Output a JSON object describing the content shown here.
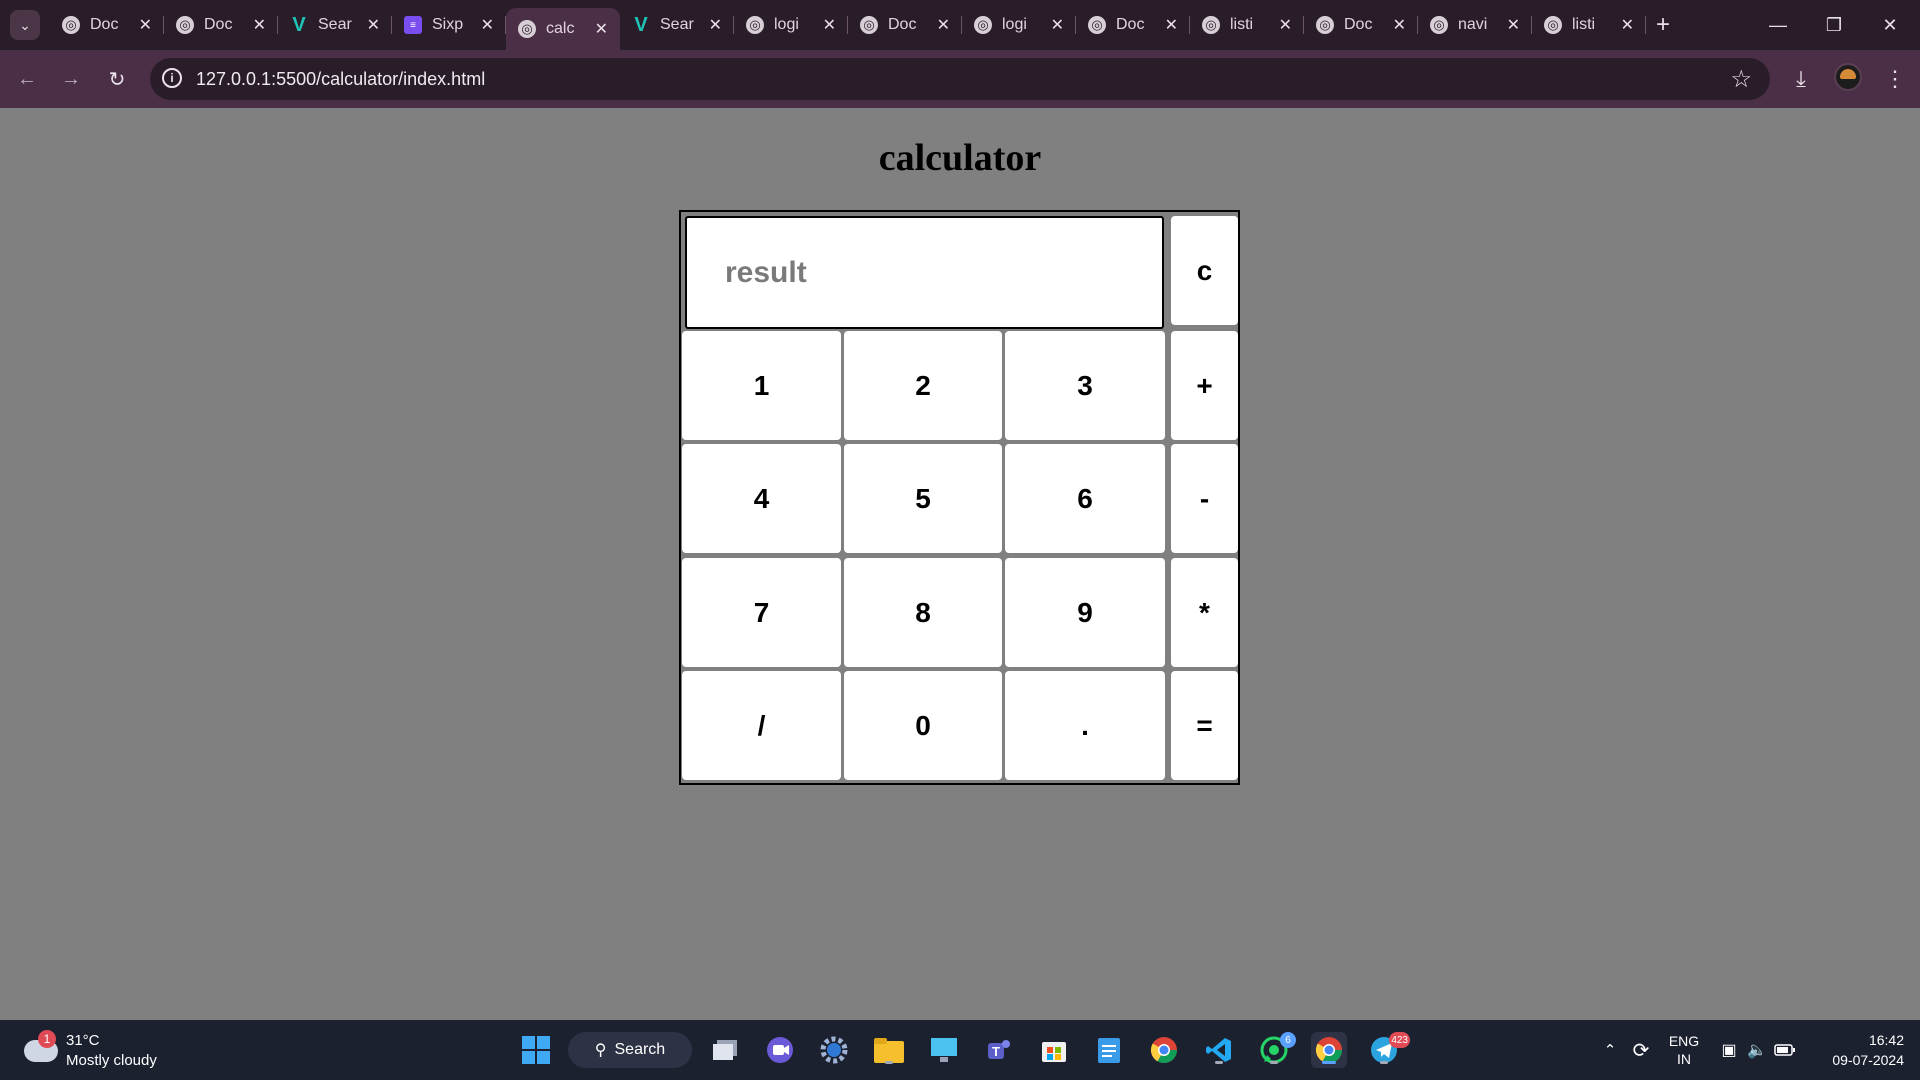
{
  "browser": {
    "tabs": [
      {
        "title": "Doc",
        "icon": "globe",
        "active": false
      },
      {
        "title": "Doc",
        "icon": "globe",
        "active": false
      },
      {
        "title": "Sear",
        "icon": "vuetify-v",
        "active": false
      },
      {
        "title": "Sixp",
        "icon": "list",
        "active": false
      },
      {
        "title": "calc",
        "icon": "globe",
        "active": true
      },
      {
        "title": "Sear",
        "icon": "vuetify-v",
        "active": false
      },
      {
        "title": "logi",
        "icon": "globe",
        "active": false
      },
      {
        "title": "Doc",
        "icon": "globe",
        "active": false
      },
      {
        "title": "logi",
        "icon": "globe",
        "active": false
      },
      {
        "title": "Doc",
        "icon": "globe",
        "active": false
      },
      {
        "title": "listi",
        "icon": "globe",
        "active": false
      },
      {
        "title": "Doc",
        "icon": "globe",
        "active": false
      },
      {
        "title": "navi",
        "icon": "globe",
        "active": false
      },
      {
        "title": "listi",
        "icon": "globe",
        "active": false
      }
    ],
    "url": "127.0.0.1:5500/calculator/index.html"
  },
  "page": {
    "title": "calculator",
    "result_placeholder": "result",
    "clear_label": "c",
    "keys": [
      {
        "label": "1",
        "name": "key-1"
      },
      {
        "label": "2",
        "name": "key-2"
      },
      {
        "label": "3",
        "name": "key-3"
      },
      {
        "label": "+",
        "name": "key-plus"
      },
      {
        "label": "4",
        "name": "key-4"
      },
      {
        "label": "5",
        "name": "key-5"
      },
      {
        "label": "6",
        "name": "key-6"
      },
      {
        "label": "-",
        "name": "key-minus"
      },
      {
        "label": "7",
        "name": "key-7"
      },
      {
        "label": "8",
        "name": "key-8"
      },
      {
        "label": "9",
        "name": "key-9"
      },
      {
        "label": "*",
        "name": "key-multiply"
      },
      {
        "label": "/",
        "name": "key-divide"
      },
      {
        "label": "0",
        "name": "key-0"
      },
      {
        "label": ".",
        "name": "key-decimal"
      },
      {
        "label": "=",
        "name": "key-equals"
      }
    ]
  },
  "taskbar": {
    "weather_temp": "31°C",
    "weather_condition": "Mostly cloudy",
    "weather_badge": "1",
    "search_label": "Search",
    "whatsapp_badge": "6",
    "telegram_badge": "423",
    "lang_top": "ENG",
    "lang_bottom": "IN",
    "time": "16:42",
    "date": "09-07-2024"
  }
}
